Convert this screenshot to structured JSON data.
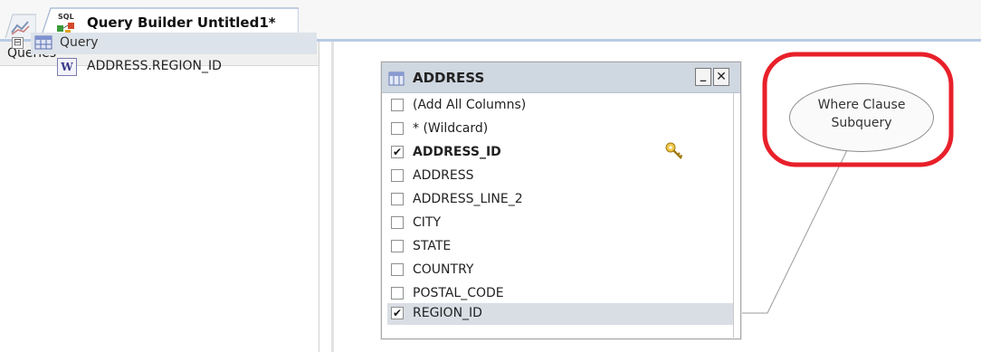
{
  "tab": {
    "inactive_icon": "chart-line-icon",
    "active_icon": "sql-query-icon",
    "title": "Query Builder Untitled1*"
  },
  "left_panel": {
    "header": "Queries",
    "tree": {
      "toggle": "⊟",
      "query_label": "Query",
      "child_icon_letter": "W",
      "child_label": "ADDRESS.REGION_ID"
    }
  },
  "table": {
    "name": "ADDRESS",
    "minimize_label": "_",
    "close_label": "✕",
    "columns": [
      {
        "label": "(Add All Columns)",
        "checked": false,
        "bold": false,
        "selected": false
      },
      {
        "label": "* (Wildcard)",
        "checked": false,
        "bold": false,
        "selected": false
      },
      {
        "label": "ADDRESS_ID",
        "checked": true,
        "bold": true,
        "selected": false,
        "primary_key": true
      },
      {
        "label": "ADDRESS",
        "checked": false,
        "bold": false,
        "selected": false
      },
      {
        "label": "ADDRESS_LINE_2",
        "checked": false,
        "bold": false,
        "selected": false
      },
      {
        "label": "CITY",
        "checked": false,
        "bold": false,
        "selected": false
      },
      {
        "label": "STATE",
        "checked": false,
        "bold": false,
        "selected": false
      },
      {
        "label": "COUNTRY",
        "checked": false,
        "bold": false,
        "selected": false
      },
      {
        "label": "POSTAL_CODE",
        "checked": false,
        "bold": false,
        "selected": false
      },
      {
        "label": "REGION_ID",
        "checked": true,
        "bold": false,
        "selected": true
      }
    ]
  },
  "subquery": {
    "line1": "Where Clause",
    "line2": "Subquery"
  },
  "colors": {
    "highlight_ring": "#e8202a",
    "titlebar": "#cfd7e1",
    "selection": "#d9dee5",
    "tab_accent": "#b9cbe4"
  }
}
